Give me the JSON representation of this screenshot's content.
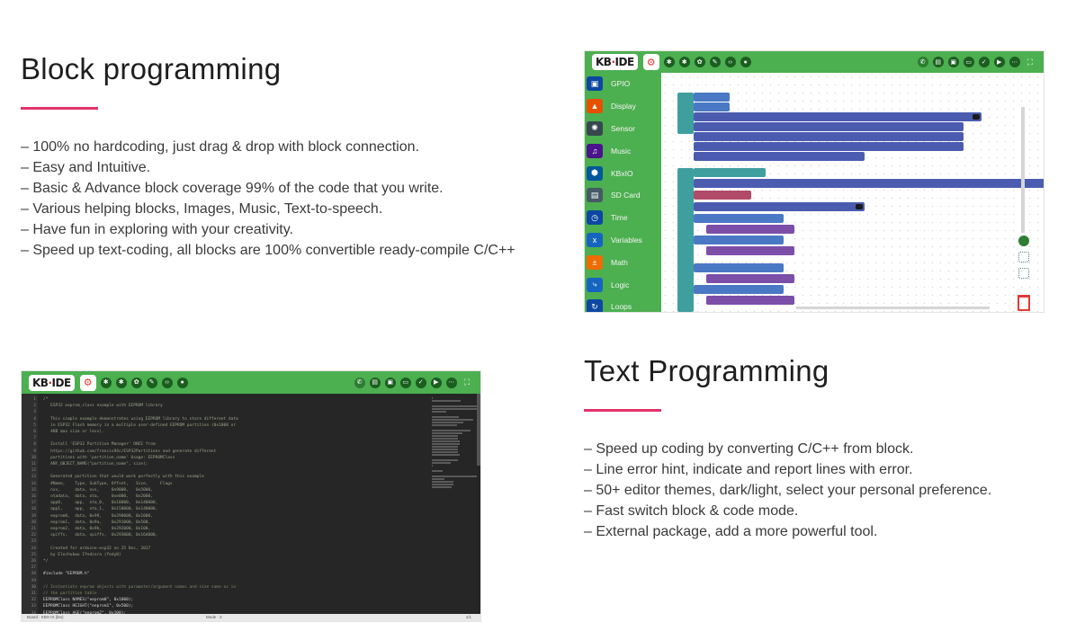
{
  "block_section": {
    "title": "Block programming",
    "bullets": [
      "– 100% no hardcoding, just drag & drop with block connection.",
      "– Easy and Intuitive.",
      "– Basic & Advance block coverage 99% of the code that you write.",
      "– Various helping blocks, Images, Music, Text-to-speech.",
      "– Have fun in exploring with your creativity.",
      "– Speed up text-coding, all blocks are 100% convertible ready-compile C/C++"
    ]
  },
  "text_section": {
    "title": "Text Programming",
    "bullets": [
      "– Speed up coding by converting C/C++ from block.",
      "– Line error hint, indicate and report lines with error.",
      "– 50+ editor themes, dark/light, select your personal preference.",
      "– Fast switch block & code mode.",
      "– External package, add a more powerful tool."
    ]
  },
  "ide": {
    "logo_left": "KB",
    "logo_right": "IDE",
    "categories": [
      {
        "label": "GPIO",
        "icon": "chip-icon",
        "glyph": "▣",
        "color": "#0d47a1"
      },
      {
        "label": "Display",
        "icon": "display-icon",
        "glyph": "▲",
        "color": "#e65100"
      },
      {
        "label": "Sensor",
        "icon": "sensor-icon",
        "glyph": "✺",
        "color": "#37474f"
      },
      {
        "label": "Music",
        "icon": "music-icon",
        "glyph": "♫",
        "color": "#4a148c"
      },
      {
        "label": "KBxIO",
        "icon": "kbxio-icon",
        "glyph": "⬢",
        "color": "#01579b"
      },
      {
        "label": "SD Card",
        "icon": "sdcard-icon",
        "glyph": "▤",
        "color": "#455a64"
      },
      {
        "label": "Time",
        "icon": "clock-icon",
        "glyph": "◷",
        "color": "#0d47a1"
      },
      {
        "label": "Variables",
        "icon": "variables-icon",
        "glyph": "x",
        "color": "#1565c0"
      },
      {
        "label": "Math",
        "icon": "math-icon",
        "glyph": "±",
        "color": "#ef6c00"
      },
      {
        "label": "Logic",
        "icon": "logic-icon",
        "glyph": "⤷",
        "color": "#1565c0"
      },
      {
        "label": "Loops",
        "icon": "loops-icon",
        "glyph": "↻",
        "color": "#0d47a1"
      }
    ],
    "code_lines": [
      {
        "n": "1",
        "t": "/*"
      },
      {
        "n": "2",
        "t": "   ESP32 eeprom_class example with EEPROM library"
      },
      {
        "n": "3",
        "t": ""
      },
      {
        "n": "4",
        "t": "   This simple example demonstrates using EEPROM library to store different data"
      },
      {
        "n": "5",
        "t": "   in ESP32 Flash memory in a multiple user-defined EEPROM partition (0x1000 or"
      },
      {
        "n": "6",
        "t": "   4KB max size or less)."
      },
      {
        "n": "7",
        "t": ""
      },
      {
        "n": "8",
        "t": "   Install 'ESP32 Partition Manager' ONCE from"
      },
      {
        "n": "9",
        "t": "   https://github.com/francis94c/ESP32Partitions and generate different"
      },
      {
        "n": "10",
        "t": "   partitions with 'partition_name' Usage: EEPROMClass"
      },
      {
        "n": "11",
        "t": "   ANY_OBJECT_NAME(\"partition_name\", size);"
      },
      {
        "n": "12",
        "t": ""
      },
      {
        "n": "13",
        "t": "   Generated partition that would work perfectly with this example"
      },
      {
        "n": "14",
        "t": "   #Name,    Type, SubType, Offset,   Size,     Flags"
      },
      {
        "n": "15",
        "t": "   nvs,      data, nvs,     0x9000,   0x5000,"
      },
      {
        "n": "16",
        "t": "   otadata,  data, ota,     0xe000,   0x2000,"
      },
      {
        "n": "17",
        "t": "   app0,     app,  ota_0,   0x10000,  0x140000,"
      },
      {
        "n": "18",
        "t": "   app1,     app,  ota_1,   0x150000, 0x140000,"
      },
      {
        "n": "19",
        "t": "   eeprom0,  data, 0x99,    0x290000, 0x1000,"
      },
      {
        "n": "20",
        "t": "   eeprom1,  data, 0x9a,    0x291000, 0x500,"
      },
      {
        "n": "21",
        "t": "   eeprom2,  data, 0x9b,    0x292000, 0x100,"
      },
      {
        "n": "22",
        "t": "   spiffs,   data, spiffs,  0x293000, 0x16d000,"
      },
      {
        "n": "23",
        "t": ""
      },
      {
        "n": "24",
        "t": "   Created for arduino-esp32 on 25 Dec, 2017"
      },
      {
        "n": "25",
        "t": "   by Elochukwu Ifediora (fedy0)"
      },
      {
        "n": "26",
        "t": "*/"
      },
      {
        "n": "27",
        "t": ""
      },
      {
        "n": "28",
        "t": "#include \"EEPROM.h\""
      },
      {
        "n": "29",
        "t": ""
      },
      {
        "n": "30",
        "t": "// Instantiate eeprom objects with parameter/argument names and size same as in"
      },
      {
        "n": "31",
        "t": "// the partition table"
      },
      {
        "n": "32",
        "t": "EEPROMClass NAMES(\"eeprom0\", 0x1000);"
      },
      {
        "n": "33",
        "t": "EEPROMClass HEIGHT(\"eeprom1\", 0x500);"
      },
      {
        "n": "34",
        "t": "EEPROMClass AGE(\"eeprom2\", 0x100);"
      }
    ],
    "status_text": "Board : KBX-IX (lite)",
    "status_mode": "Mode : 3",
    "status_right": "1/1",
    "colors": {
      "green": "#4caf50",
      "accent": "#e2336b",
      "editor_bg": "#262626"
    }
  }
}
